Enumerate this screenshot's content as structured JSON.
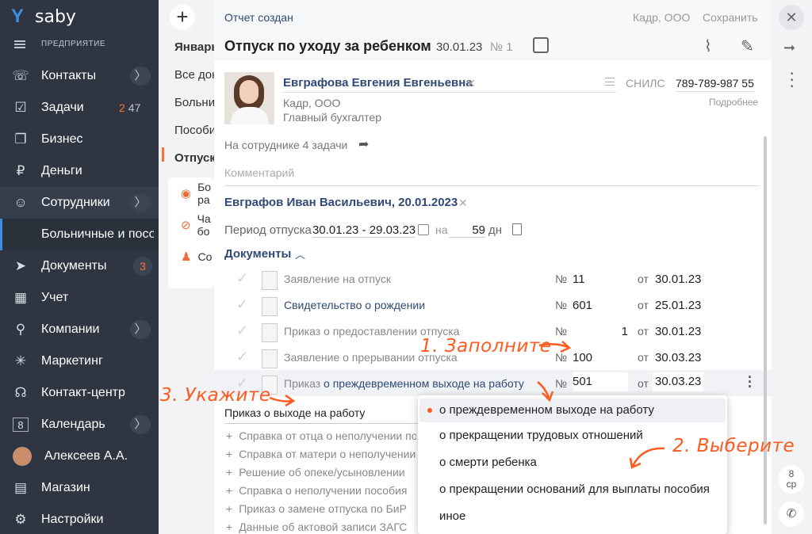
{
  "app": {
    "logo": "saby",
    "section": "ПРЕДПРИЯТИЕ"
  },
  "nav": [
    {
      "label": "Контакты",
      "icon": "contacts-icon",
      "glyph": "☏",
      "arrow": "〉"
    },
    {
      "label": "Задачи",
      "icon": "tasks-icon",
      "glyph": "☑",
      "counter_a": "2",
      "counter_b": "47"
    },
    {
      "label": "Бизнес",
      "icon": "business-icon",
      "glyph": "❐"
    },
    {
      "label": "Деньги",
      "icon": "money-icon",
      "glyph": "₽"
    },
    {
      "label": "Сотрудники",
      "icon": "employees-icon",
      "glyph": "☺",
      "arrow": "〉"
    },
    {
      "label": "Больничные и пособия",
      "icon": "",
      "glyph": ""
    },
    {
      "label": "Документы",
      "icon": "documents-icon",
      "glyph": "➤",
      "counter": "3"
    },
    {
      "label": "Учет",
      "icon": "accounting-icon",
      "glyph": "▦"
    },
    {
      "label": "Компании",
      "icon": "companies-icon",
      "glyph": "⚲",
      "arrow": "〉"
    },
    {
      "label": "Маркетинг",
      "icon": "marketing-icon",
      "glyph": "✳"
    },
    {
      "label": "Контакт-центр",
      "icon": "contact-center-icon",
      "glyph": "☊"
    },
    {
      "label": "Календарь",
      "icon": "calendar-icon",
      "glyph": "8",
      "arrow": "〉"
    },
    {
      "label": "Алексеев А.А.",
      "icon": "user-avatar",
      "glyph": ""
    },
    {
      "label": "Магазин",
      "icon": "shop-icon",
      "glyph": "▤"
    },
    {
      "label": "Настройки",
      "icon": "settings-icon",
      "glyph": "⚙"
    }
  ],
  "middle": {
    "plus": "+",
    "items": [
      "Январь",
      "Все документы",
      "Больничные",
      "Пособия",
      "Отпуск"
    ],
    "cards": [
      {
        "icon": "coins-icon",
        "text": "Бо ра"
      },
      {
        "icon": "pills-icon",
        "text": "Ча бо"
      },
      {
        "icon": "people-icon",
        "text": "Со"
      }
    ]
  },
  "dialog": {
    "status": "Отчет создан",
    "org": "Кадр, ООО",
    "save": "Сохранить",
    "title": "Отпуск по уходу за ребенком",
    "date": "30.01.23",
    "number": "№ 1",
    "employee": {
      "name": "Евграфова Евгения Евгеньевна",
      "org": "Кадр, ООО",
      "position": "Главный бухгалтер",
      "snils_label": "СНИЛС",
      "snils": "789-789-987 55",
      "more": "Подробнее"
    },
    "tasks": "На сотруднике 4 задачи",
    "comment_placeholder": "Комментарий",
    "child": "Евграфов Иван Васильевич, 20.01.2023",
    "period": {
      "label": "Период отпуска",
      "from": "30.01.23",
      "to": "29.03.23",
      "on": "на",
      "days": "59",
      "days_unit": "дн"
    },
    "documents_label": "Документы",
    "documents": [
      {
        "name": "Заявление на отпуск",
        "num_label": "№",
        "num": "11",
        "ot": "от",
        "date": "30.01.23"
      },
      {
        "name": "Свидетельство о рождении",
        "num_label": "№",
        "num": "601",
        "ot": "от",
        "date": "25.01.23"
      },
      {
        "name": "Приказ о предоставлении отпуска",
        "num_label": "№",
        "num": "1",
        "ot": "от",
        "date": "30.01.23"
      },
      {
        "name": "Заявление о прерывании отпуска",
        "num_label": "№",
        "num": "100",
        "ot": "от",
        "date": "30.03.23"
      },
      {
        "name_prefix": "Приказ ",
        "name_link": "о преждевременном выходе на работу",
        "num_label": "№",
        "num": "501",
        "ot": "от",
        "date": "30.03.23"
      }
    ],
    "type_value": "Приказ о выходе на работу",
    "add_items": [
      "Справка от отца о неполучении пособия",
      "Справка от матери о неполучении пособия",
      "Решение об опеке/усыновлении",
      "Справка о неполучении пособия",
      "Приказ о замене отпуска по БиР",
      "Данные об актовой записи ЗАГС"
    ]
  },
  "dropdown": {
    "options": [
      "о преждевременном выходе на работу",
      "о прекращении трудовых отношений",
      "о смерти ребенка",
      "о прекращении оснований для выплаты пособия",
      "иное"
    ],
    "selected": 0
  },
  "annotations": {
    "fill": "1. Заполните",
    "choose": "2. Выберите",
    "specify": "3. Укажите"
  },
  "rightbar": {
    "close": "✕",
    "day": "8",
    "weekday": "ср"
  },
  "colors": {
    "accent": "#ff5a1f",
    "sidebar": "#2f3642",
    "link": "#2f4a74"
  }
}
